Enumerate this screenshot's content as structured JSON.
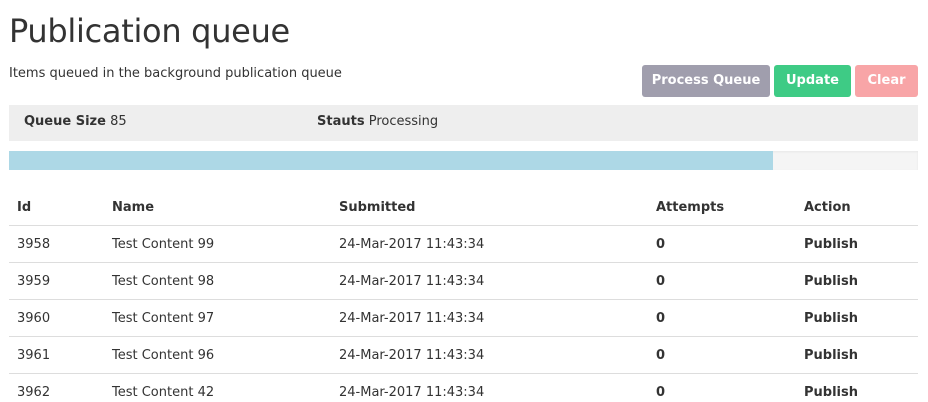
{
  "header": {
    "title": "Publication queue",
    "subtitle": "Items queued in the background publication queue"
  },
  "buttons": {
    "process_label": "Process Queue",
    "process_color": "#a09ead",
    "update_label": "Update",
    "update_color": "#3ecb85",
    "clear_label": "Clear",
    "clear_color": "#f8a5a7"
  },
  "status": {
    "size_label": "Queue Size",
    "size_value": "85",
    "state_label": "Stauts",
    "state_value": "Processing"
  },
  "progress": {
    "fraction": 0.84,
    "color": "#add8e6"
  },
  "table": {
    "columns": [
      "Id",
      "Name",
      "Submitted",
      "Attempts",
      "Action"
    ],
    "rows": [
      {
        "id": "3958",
        "name": "Test Content 99",
        "submitted": "24-Mar-2017 11:43:34",
        "attempts": "0",
        "action": "Publish"
      },
      {
        "id": "3959",
        "name": "Test Content 98",
        "submitted": "24-Mar-2017 11:43:34",
        "attempts": "0",
        "action": "Publish"
      },
      {
        "id": "3960",
        "name": "Test Content 97",
        "submitted": "24-Mar-2017 11:43:34",
        "attempts": "0",
        "action": "Publish"
      },
      {
        "id": "3961",
        "name": "Test Content 96",
        "submitted": "24-Mar-2017 11:43:34",
        "attempts": "0",
        "action": "Publish"
      },
      {
        "id": "3962",
        "name": "Test Content 42",
        "submitted": "24-Mar-2017 11:43:34",
        "attempts": "0",
        "action": "Publish"
      }
    ]
  }
}
